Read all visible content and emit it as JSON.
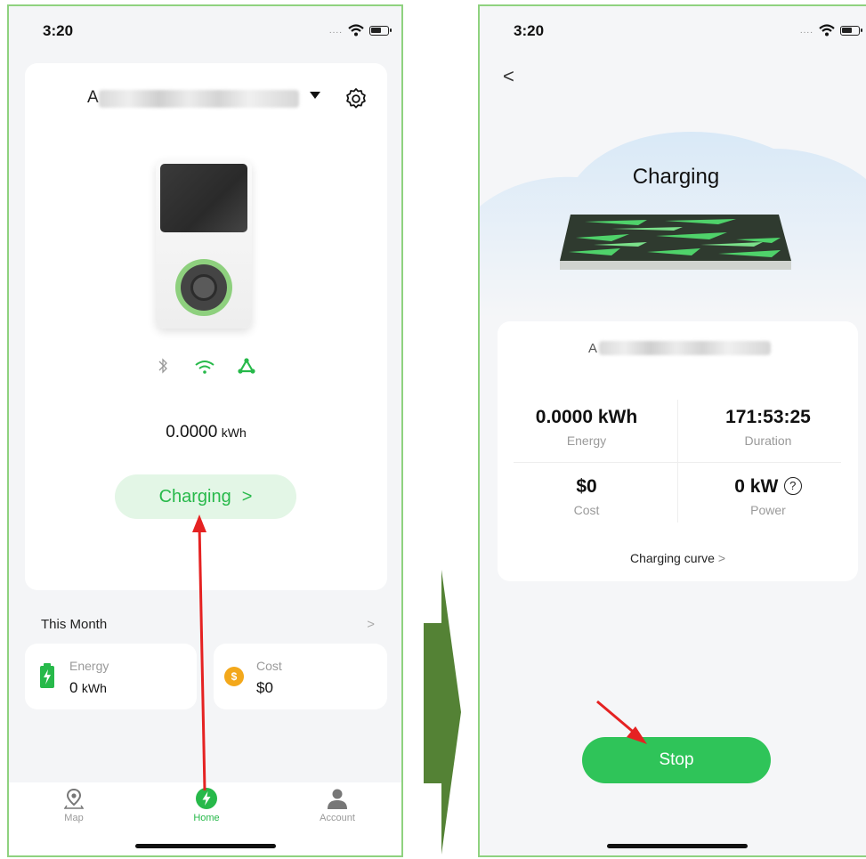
{
  "left_screen": {
    "status_time": "3:20",
    "device_name_prefix": "A",
    "reading_value": "0.0000",
    "reading_unit": "kWh",
    "charging_label": "Charging",
    "charging_chevron": ">",
    "this_month_label": "This Month",
    "this_month_chevron": ">",
    "energy_label": "Energy",
    "energy_value": "0",
    "energy_unit": "kWh",
    "cost_label": "Cost",
    "cost_value": "$0",
    "cost_icon_glyph": "$",
    "tabs": [
      {
        "label": "Map",
        "icon": "map-pin-icon"
      },
      {
        "label": "Home",
        "icon": "lightning-icon"
      },
      {
        "label": "Account",
        "icon": "user-icon"
      }
    ],
    "colors": {
      "accent": "#27b94a",
      "pill_bg": "#e3f6e6",
      "cost_icon": "#f3a81b"
    }
  },
  "right_screen": {
    "status_time": "3:20",
    "back_glyph": "<",
    "title": "Charging",
    "device_name_prefix": "A",
    "stats": [
      {
        "value": "0.0000 kWh",
        "label": "Energy"
      },
      {
        "value": "171:53:25",
        "label": "Duration"
      },
      {
        "value": "$0",
        "label": "Cost"
      },
      {
        "value": "0 kW",
        "label": "Power"
      }
    ],
    "help_glyph": "?",
    "charging_curve_label": "Charging curve",
    "charging_curve_chevron": ">",
    "stop_label": "Stop",
    "colors": {
      "stop_button": "#2fc459",
      "annotation_arrow": "#e52222",
      "flow_arrow": "#548235"
    }
  }
}
